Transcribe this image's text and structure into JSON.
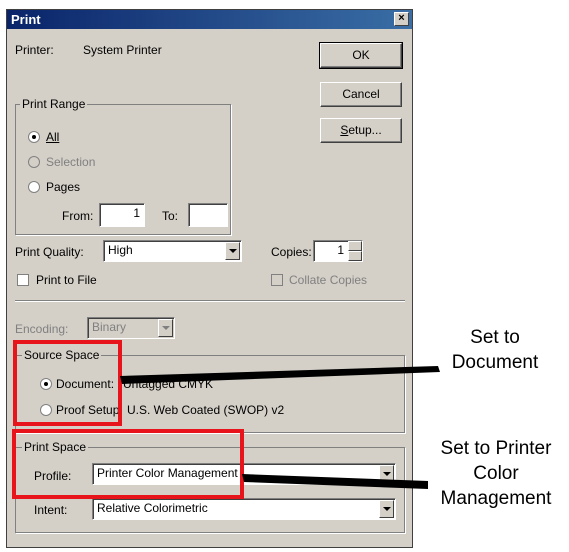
{
  "dialog": {
    "title": "Print",
    "close_glyph": "×"
  },
  "printer": {
    "label": "Printer:",
    "value": "System Printer"
  },
  "buttons": {
    "ok": "OK",
    "cancel": "Cancel",
    "setup": "Setup..."
  },
  "print_range": {
    "legend": "Print Range",
    "all": "All",
    "selection": "Selection",
    "pages": "Pages",
    "from_label": "From:",
    "from_value": "1",
    "to_label": "To:",
    "to_value": ""
  },
  "quality": {
    "label": "Print Quality:",
    "value": "High"
  },
  "copies": {
    "label": "Copies:",
    "value": "1"
  },
  "print_to_file": "Print to File",
  "collate": "Collate Copies",
  "encoding": {
    "label": "Encoding:",
    "value": "Binary"
  },
  "source_space": {
    "legend": "Source Space",
    "document_label": "Document:",
    "document_value": "Untagged CMYK",
    "proof_label": "Proof Setup:",
    "proof_value": "U.S. Web Coated (SWOP) v2"
  },
  "print_space": {
    "legend": "Print Space",
    "profile_label": "Profile:",
    "profile_value": "Printer Color Management",
    "intent_label": "Intent:",
    "intent_value": "Relative Colorimetric"
  },
  "annotations": {
    "a1_line1": "Set to",
    "a1_line2": "Document",
    "a2_line1": "Set to Printer",
    "a2_line2": "Color",
    "a2_line3": "Management"
  },
  "colors": {
    "highlight": "#e8141c",
    "titlebar": "#0a246a",
    "dialog_bg": "#d4d0c8"
  }
}
